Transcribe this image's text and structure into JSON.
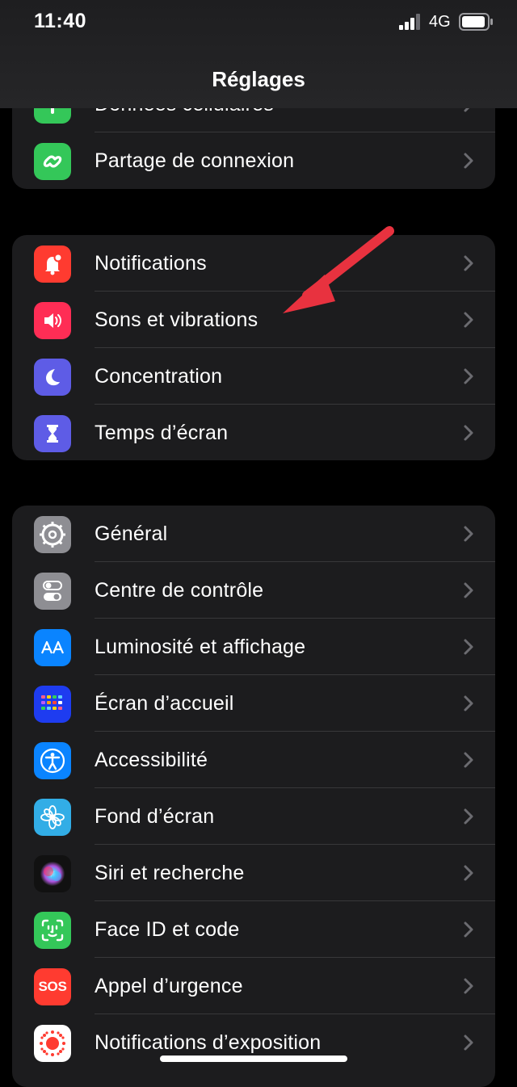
{
  "status_bar": {
    "time": "11:40",
    "network": "4G"
  },
  "nav": {
    "title": "Réglages"
  },
  "groups": [
    {
      "items": [
        {
          "label": "Données cellulaires",
          "icon": "antenna-icon",
          "color": "#34c759"
        },
        {
          "label": "Partage de connexion",
          "icon": "chain-link-icon",
          "color": "#34c759"
        }
      ]
    },
    {
      "items": [
        {
          "label": "Notifications",
          "icon": "bell-badge-icon",
          "color": "#ff3b30"
        },
        {
          "label": "Sons et vibrations",
          "icon": "speaker-icon",
          "color": "#ff2d55"
        },
        {
          "label": "Concentration",
          "icon": "moon-icon",
          "color": "#5e5ce6"
        },
        {
          "label": "Temps d’écran",
          "icon": "hourglass-icon",
          "color": "#5e5ce6"
        }
      ]
    },
    {
      "items": [
        {
          "label": "Général",
          "icon": "gear-icon",
          "color": "#8e8e93"
        },
        {
          "label": "Centre de contrôle",
          "icon": "toggles-icon",
          "color": "#8e8e93"
        },
        {
          "label": "Luminosité et affichage",
          "icon": "text-size-icon",
          "color": "#0a84ff"
        },
        {
          "label": "Écran d’accueil",
          "icon": "app-grid-icon",
          "color": "#1e3cf0"
        },
        {
          "label": "Accessibilité",
          "icon": "accessibility-icon",
          "color": "#0a84ff"
        },
        {
          "label": "Fond d’écran",
          "icon": "flower-icon",
          "color": "#32ade6"
        },
        {
          "label": "Siri et recherche",
          "icon": "siri-icon",
          "color": "#1a1a1a"
        },
        {
          "label": "Face ID et code",
          "icon": "face-id-icon",
          "color": "#34c759"
        },
        {
          "label": "Appel d’urgence",
          "icon": "sos-icon",
          "color": "#ff3b30",
          "icon_text": "SOS"
        },
        {
          "label": "Notifications d’exposition",
          "icon": "exposure-icon",
          "color": "#ffffff"
        }
      ]
    }
  ],
  "annotation": {
    "arrow_color": "#e8323f",
    "points_to": "Sons et vibrations"
  }
}
